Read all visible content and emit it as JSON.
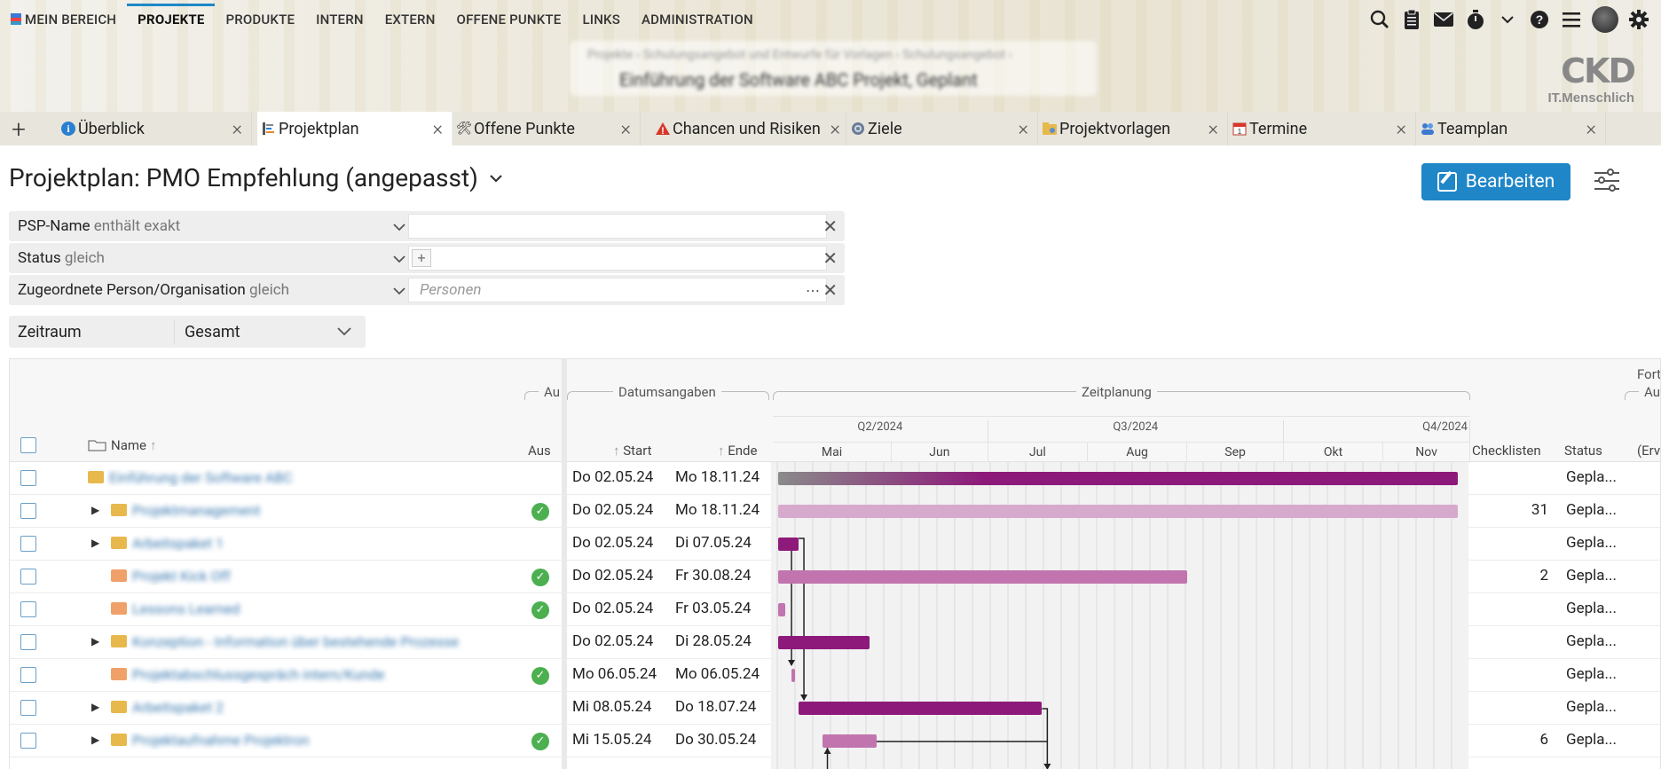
{
  "nav": {
    "items": [
      "MEIN BEREICH",
      "PROJEKTE",
      "PRODUKTE",
      "INTERN",
      "EXTERN",
      "OFFENE PUNKTE",
      "LINKS",
      "ADMINISTRATION"
    ],
    "active": "PROJEKTE",
    "icons": [
      "search-icon",
      "clipboard-icon",
      "mail-icon",
      "timer-icon",
      "chevron-down-icon",
      "help-icon",
      "menu-icon",
      "avatar",
      "gear-icon"
    ]
  },
  "breadcrumb": {
    "line1": "Projekte  ›  Schulungsangebot und Entwurfe für Vorlagen  ›  Schulungsangebot  ›",
    "line2": "Einführung der Software ABC  Projekt, Geplant"
  },
  "logo": {
    "main": "CKD",
    "sub": "IT.Menschlich"
  },
  "tabs": [
    {
      "label": "Überblick",
      "icon": "info-icon"
    },
    {
      "label": "Projektplan",
      "icon": "plan-icon"
    },
    {
      "label": "Offene Punkte",
      "icon": "tools-icon"
    },
    {
      "label": "Chancen und Risiken",
      "icon": "warning-icon"
    },
    {
      "label": "Ziele",
      "icon": "goal-icon"
    },
    {
      "label": "Projektvorlagen",
      "icon": "template-icon"
    },
    {
      "label": "Termine",
      "icon": "calendar-icon"
    },
    {
      "label": "Teamplan",
      "icon": "team-icon"
    }
  ],
  "page": {
    "title": "Projektplan: PMO Empfehlung (angepasst)",
    "edit_button": "Bearbeiten"
  },
  "filters": [
    {
      "field": "PSP-Name",
      "op": "enthält exakt",
      "value": "",
      "placeholder": ""
    },
    {
      "field": "Status",
      "op": "gleich",
      "value": "",
      "placeholder": ""
    },
    {
      "field": "Zugeordnete Person/Organisation",
      "op": "gleich",
      "value": "",
      "placeholder": "Personen"
    }
  ],
  "zeitraum": {
    "label": "Zeitraum",
    "value": "Gesamt"
  },
  "grid": {
    "groups": {
      "au": "Au",
      "datum": "Datumsangaben",
      "zeit": "Zeitplanung",
      "fort": "Fort",
      "auf": "Auf"
    },
    "columns": {
      "name": "Name",
      "aus": "Aus",
      "start": "Start",
      "ende": "Ende",
      "checklisten": "Checklisten",
      "status": "Status",
      "erv": "(Erv"
    },
    "quarters": [
      "Q2/2024",
      "Q3/2024",
      "Q4/2024"
    ],
    "months": [
      "Mai",
      "Jun",
      "Jul",
      "Aug",
      "Sep",
      "Okt",
      "Nov"
    ],
    "rows": [
      {
        "name": "Einführung der Software ABC",
        "start": "Do 02.05.24",
        "ende": "Mo 18.11.24",
        "check": false,
        "checklisten": "",
        "status": "Gepla...",
        "expand": false,
        "indent": 0
      },
      {
        "name": "Projektmanagement",
        "start": "Do 02.05.24",
        "ende": "Mo 18.11.24",
        "check": true,
        "checklisten": "31",
        "status": "Gepla...",
        "expand": true,
        "indent": 1
      },
      {
        "name": "Arbeitspaket 1",
        "start": "Do 02.05.24",
        "ende": "Di 07.05.24",
        "check": false,
        "checklisten": "",
        "status": "Gepla...",
        "expand": true,
        "indent": 1
      },
      {
        "name": "Projekt Kick Off",
        "start": "Do 02.05.24",
        "ende": "Fr 30.08.24",
        "check": true,
        "checklisten": "2",
        "status": "Gepla...",
        "expand": false,
        "indent": 2
      },
      {
        "name": "Lessons Learned",
        "start": "Do 02.05.24",
        "ende": "Fr 03.05.24",
        "check": true,
        "checklisten": "",
        "status": "Gepla...",
        "expand": false,
        "indent": 2
      },
      {
        "name": "Konzeption - Information über bestehende Prozesse",
        "start": "Do 02.05.24",
        "ende": "Di 28.05.24",
        "check": false,
        "checklisten": "",
        "status": "Gepla...",
        "expand": true,
        "indent": 1
      },
      {
        "name": "Projektabschlussgespräch intern/Kunde",
        "start": "Mo 06.05.24",
        "ende": "Mo 06.05.24",
        "check": true,
        "checklisten": "",
        "status": "Gepla...",
        "expand": false,
        "indent": 2
      },
      {
        "name": "Arbeitspaket 2",
        "start": "Mi 08.05.24",
        "ende": "Do 18.07.24",
        "check": false,
        "checklisten": "",
        "status": "Gepla...",
        "expand": true,
        "indent": 1
      },
      {
        "name": "Projektaufnahme Projektron",
        "start": "Mi 15.05.24",
        "ende": "Do 30.05.24",
        "check": true,
        "checklisten": "6",
        "status": "Gepla...",
        "expand": true,
        "indent": 1
      }
    ],
    "bars": [
      {
        "start": "2024-05-02",
        "end": "2024-11-18",
        "color": "#8a8a8a",
        "color2": "#8d1a7a"
      },
      {
        "start": "2024-05-02",
        "end": "2024-11-18",
        "color": "#d7a9cc"
      },
      {
        "start": "2024-05-02",
        "end": "2024-05-07",
        "color": "#8d1a7a"
      },
      {
        "start": "2024-05-02",
        "end": "2024-08-30",
        "color": "#c274ae"
      },
      {
        "start": "2024-05-02",
        "end": "2024-05-03",
        "color": "#c274ae"
      },
      {
        "start": "2024-05-02",
        "end": "2024-05-28",
        "color": "#8d1a7a"
      },
      {
        "start": "2024-05-06",
        "end": "2024-05-06",
        "color": "#c274ae"
      },
      {
        "start": "2024-05-08",
        "end": "2024-07-18",
        "color": "#8d1a7a"
      },
      {
        "start": "2024-05-15",
        "end": "2024-05-30",
        "color": "#c274ae"
      }
    ]
  }
}
